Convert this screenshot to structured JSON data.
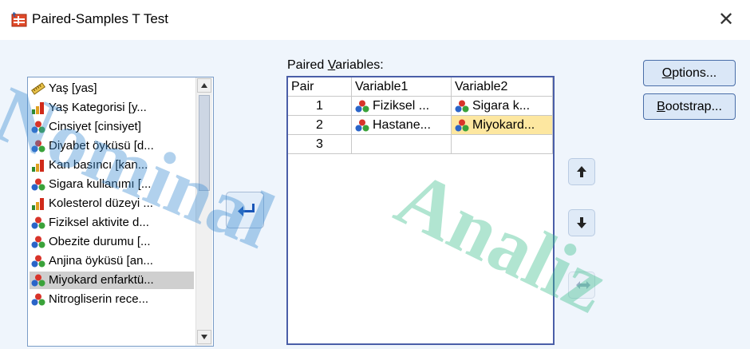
{
  "window": {
    "title": "Paired-Samples T Test",
    "close_symbol": "✕"
  },
  "source_list": {
    "items": [
      {
        "label": "Yaş [yas]",
        "icon": "ruler-scale-icon"
      },
      {
        "label": "Yaş Kategorisi [y...",
        "icon": "ordinal-bar-icon"
      },
      {
        "label": "Cinsiyet [cinsiyet]",
        "icon": "nominal-balls-icon"
      },
      {
        "label": "Diyabet öyküsü [d...",
        "icon": "nominal-balls-icon"
      },
      {
        "label": "Kan basıncı [kan...",
        "icon": "ordinal-bar-icon"
      },
      {
        "label": "Sigara kullanımı [...",
        "icon": "nominal-balls-icon"
      },
      {
        "label": "Kolesterol düzeyi ...",
        "icon": "ordinal-bar-icon"
      },
      {
        "label": "Fiziksel aktivite d...",
        "icon": "nominal-balls-icon"
      },
      {
        "label": "Obezite durumu [...",
        "icon": "nominal-balls-icon"
      },
      {
        "label": "Anjina öyküsü [an...",
        "icon": "nominal-balls-icon"
      },
      {
        "label": "Miyokard enfarktü...",
        "icon": "nominal-balls-icon",
        "selected": true
      },
      {
        "label": "Nitrogliserin rece...",
        "icon": "nominal-balls-icon"
      }
    ]
  },
  "paired": {
    "label_prefix": "Paired ",
    "label_underlined": "V",
    "label_rest": "ariables:",
    "headers": {
      "pair": "Pair",
      "var1": "Variable1",
      "var2": "Variable2"
    },
    "rows": [
      {
        "pair": "1",
        "var1": "Fiziksel ...",
        "var2": "Sigara k..."
      },
      {
        "pair": "2",
        "var1": "Hastane...",
        "var2": "Miyokard..."
      },
      {
        "pair": "3",
        "var1": "",
        "var2": ""
      }
    ]
  },
  "buttons": {
    "options_u": "O",
    "options_rest": "ptions...",
    "bootstrap_u": "B",
    "bootstrap_rest": "ootstrap..."
  },
  "watermark": {
    "line1": "Nominal",
    "line2": "Analiz"
  },
  "colors": {
    "accent_border": "#4a5ea8",
    "selection": "#fde7a0",
    "dialog_bg": "#eff5fc"
  }
}
